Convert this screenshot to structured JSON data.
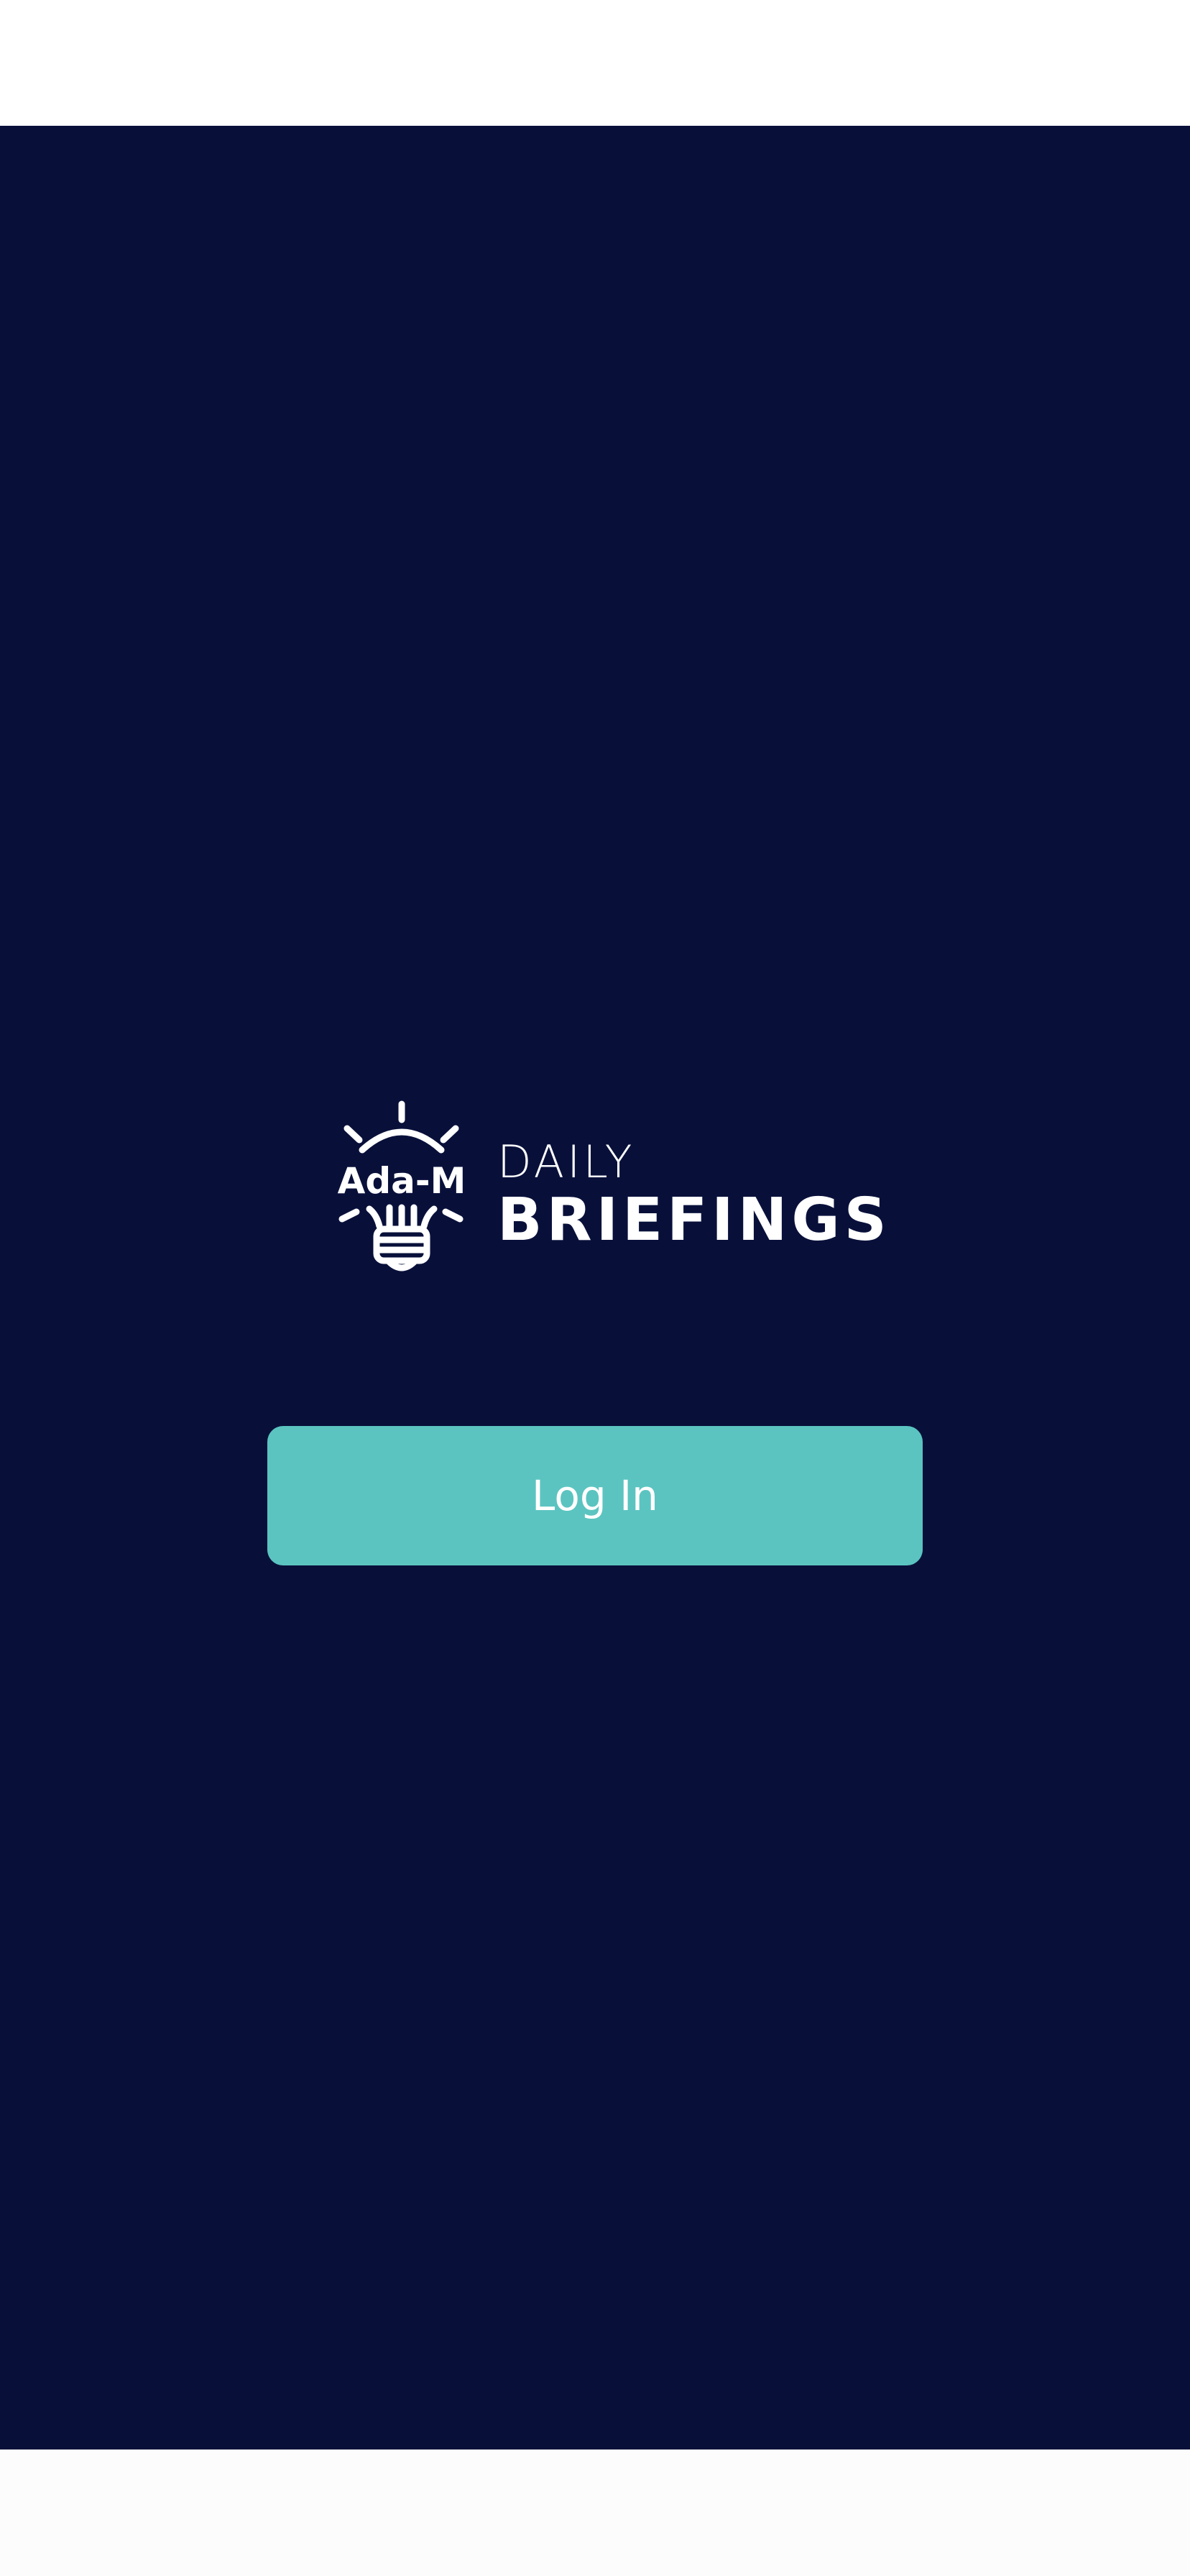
{
  "app": {
    "logo": {
      "icon_name": "lightbulb-icon",
      "icon_text": "Ada-M",
      "line1": "DAILY",
      "line2": "BRIEFINGS"
    },
    "login_button_label": "Log In"
  },
  "colors": {
    "background": "#08103a",
    "accent": "#5bc4c0",
    "text": "#ffffff"
  }
}
